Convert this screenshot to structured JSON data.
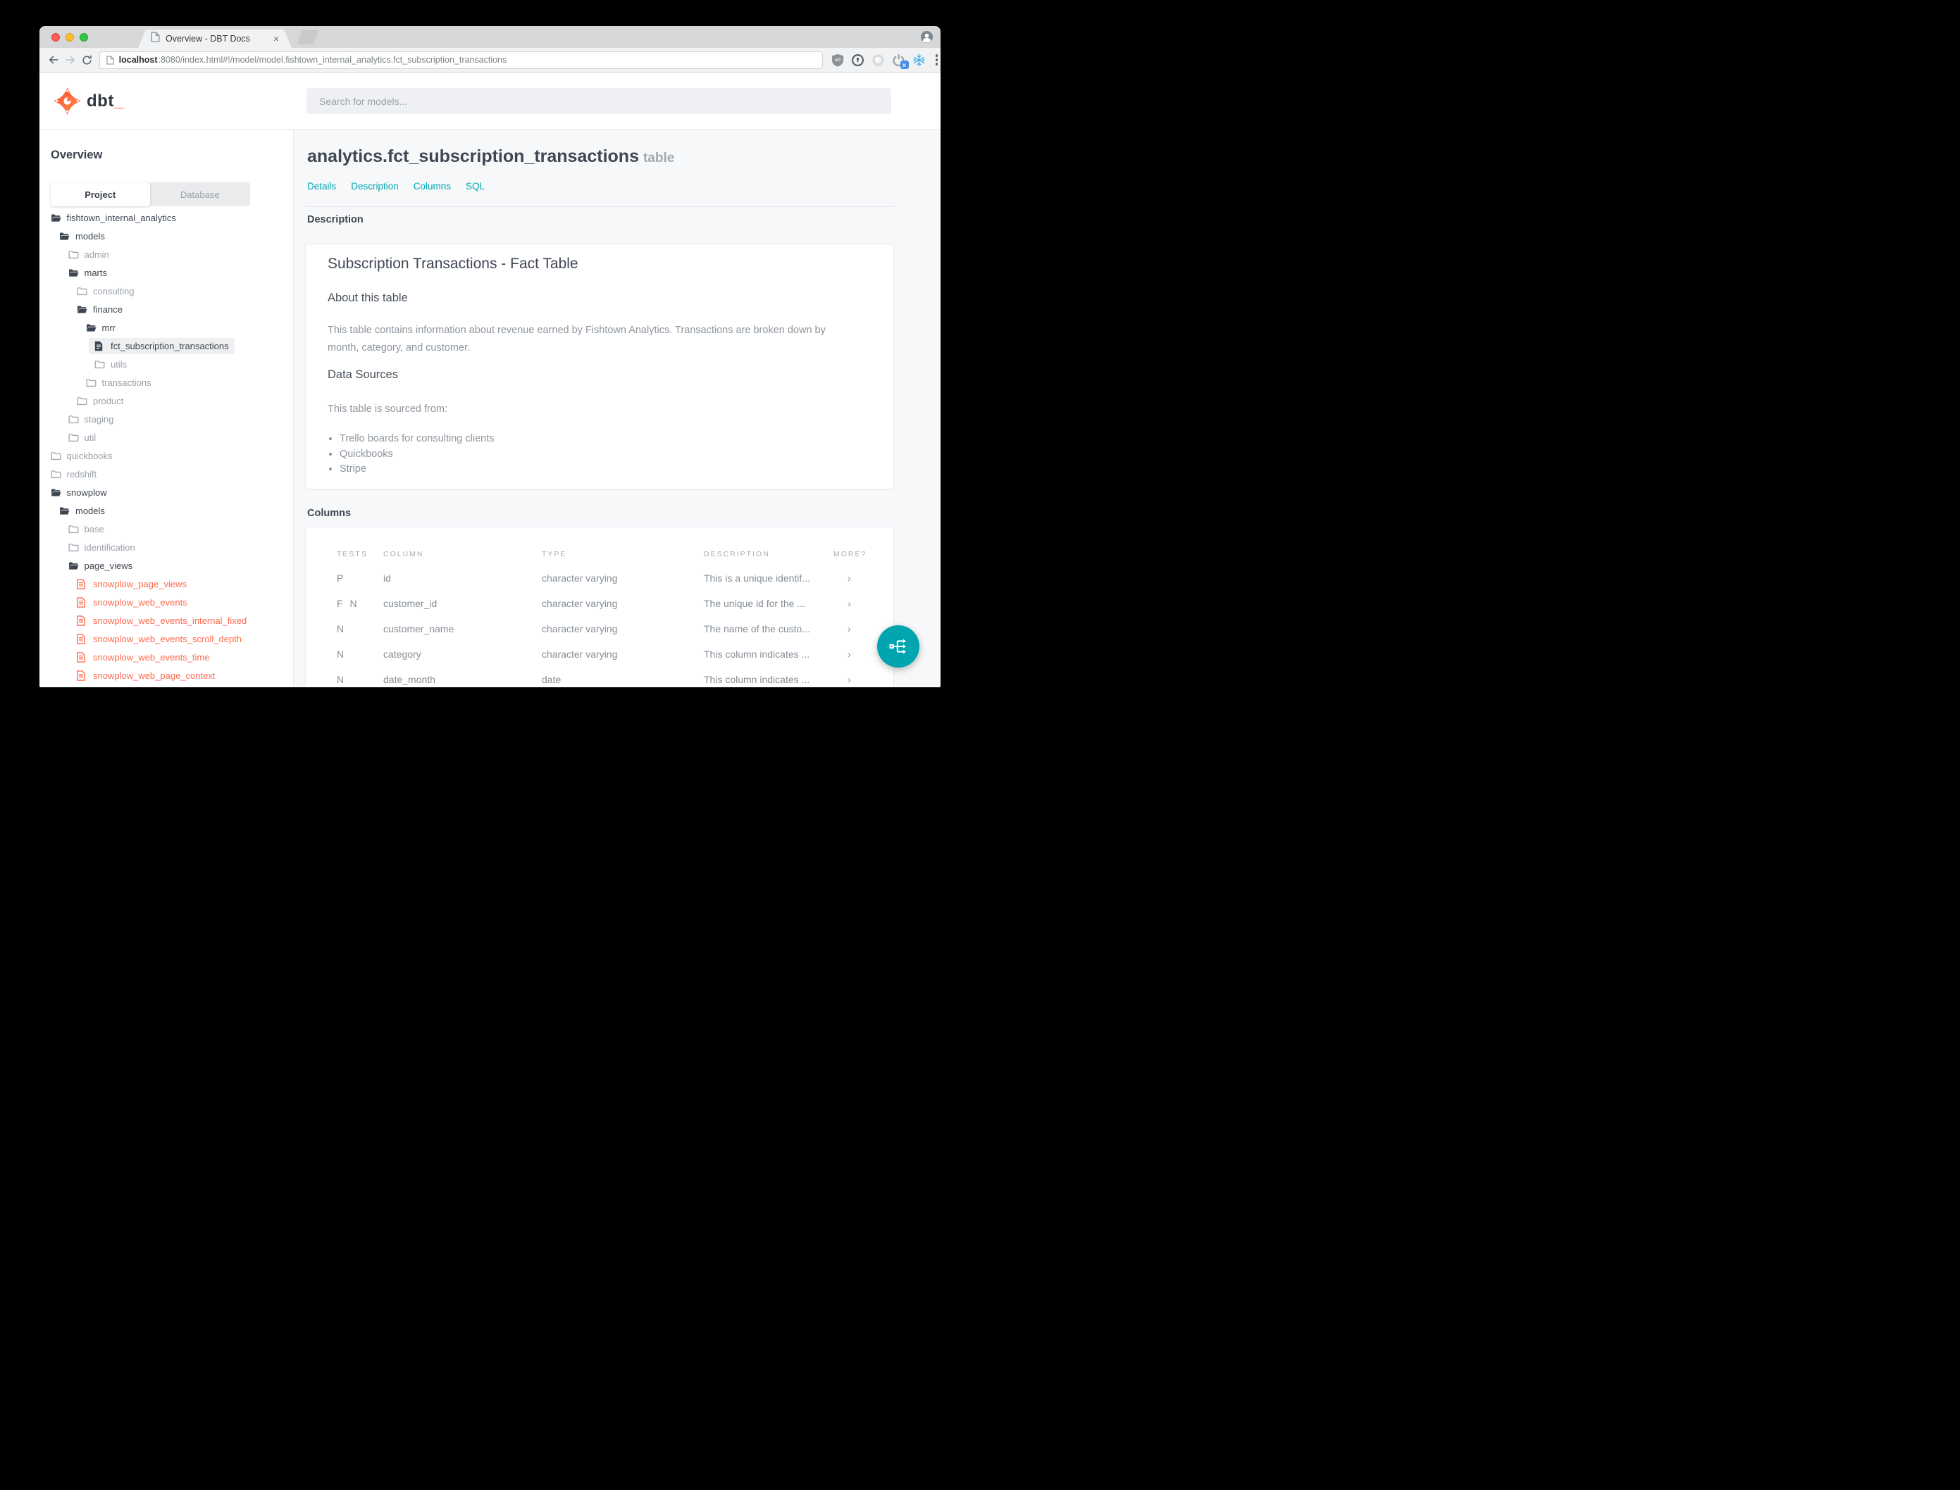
{
  "browser": {
    "tab_title": "Overview - DBT Docs",
    "close_glyph": "×",
    "url_host": "localhost",
    "url_rest": ":8080/index.html#!/model/model.fishtown_internal_analytics.fct_subscription_transactions"
  },
  "header": {
    "logo_text": "dbt",
    "logo_underscore": "_",
    "search_placeholder": "Search for models..."
  },
  "sidebar": {
    "title": "Overview",
    "tabs": {
      "project": "Project",
      "database": "Database"
    },
    "tree": [
      {
        "label": "fishtown_internal_analytics",
        "level": 0,
        "icon": "folder-open",
        "tone": "dark"
      },
      {
        "label": "models",
        "level": 1,
        "icon": "folder-open",
        "tone": "dark"
      },
      {
        "label": "admin",
        "level": 2,
        "icon": "folder-closed",
        "tone": "muted"
      },
      {
        "label": "marts",
        "level": 2,
        "icon": "folder-open",
        "tone": "dark"
      },
      {
        "label": "consulting",
        "level": 3,
        "icon": "folder-closed",
        "tone": "muted"
      },
      {
        "label": "finance",
        "level": 3,
        "icon": "folder-open",
        "tone": "dark"
      },
      {
        "label": "mrr",
        "level": 4,
        "icon": "folder-open",
        "tone": "dark"
      },
      {
        "label": "fct_subscription_transactions",
        "level": 5,
        "icon": "file-solid",
        "tone": "dark",
        "selected": true
      },
      {
        "label": "utils",
        "level": 5,
        "icon": "folder-closed",
        "tone": "muted"
      },
      {
        "label": "transactions",
        "level": 4,
        "icon": "folder-closed",
        "tone": "muted"
      },
      {
        "label": "product",
        "level": 3,
        "icon": "folder-closed",
        "tone": "muted"
      },
      {
        "label": "staging",
        "level": 2,
        "icon": "folder-closed",
        "tone": "muted"
      },
      {
        "label": "util",
        "level": 2,
        "icon": "folder-closed",
        "tone": "muted"
      },
      {
        "label": "quickbooks",
        "level": 0,
        "icon": "folder-closed",
        "tone": "muted"
      },
      {
        "label": "redshift",
        "level": 0,
        "icon": "folder-closed",
        "tone": "muted"
      },
      {
        "label": "snowplow",
        "level": 0,
        "icon": "folder-open",
        "tone": "dark"
      },
      {
        "label": "models",
        "level": 1,
        "icon": "folder-open",
        "tone": "dark"
      },
      {
        "label": "base",
        "level": 2,
        "icon": "folder-closed",
        "tone": "muted"
      },
      {
        "label": "identification",
        "level": 2,
        "icon": "folder-closed",
        "tone": "muted"
      },
      {
        "label": "page_views",
        "level": 2,
        "icon": "folder-open",
        "tone": "dark"
      },
      {
        "label": "snowplow_page_views",
        "level": 3,
        "icon": "file-lines",
        "tone": "red"
      },
      {
        "label": "snowplow_web_events",
        "level": 3,
        "icon": "file-lines",
        "tone": "red"
      },
      {
        "label": "snowplow_web_events_internal_fixed",
        "level": 3,
        "icon": "file-lines",
        "tone": "red"
      },
      {
        "label": "snowplow_web_events_scroll_depth",
        "level": 3,
        "icon": "file-lines",
        "tone": "red"
      },
      {
        "label": "snowplow_web_events_time",
        "level": 3,
        "icon": "file-lines",
        "tone": "red"
      },
      {
        "label": "snowplow_web_page_context",
        "level": 3,
        "icon": "file-lines",
        "tone": "red"
      }
    ]
  },
  "main": {
    "title": "analytics.fct_subscription_transactions",
    "title_suffix": "table",
    "nav": [
      "Details",
      "Description",
      "Columns",
      "SQL"
    ],
    "description_section": {
      "label": "Description",
      "card": {
        "heading": "Subscription Transactions - Fact Table",
        "about_heading": "About this table",
        "about_text": "This table contains information about revenue earned by Fishtown Analytics. Transactions are broken down by month, category, and customer.",
        "sources_heading": "Data Sources",
        "sources_intro": "This table is sourced from:",
        "sources": [
          "Trello boards for consulting clients",
          "Quickbooks",
          "Stripe"
        ]
      }
    },
    "columns_section": {
      "label": "Columns",
      "table": {
        "headers": [
          "TESTS",
          "COLUMN",
          "TYPE",
          "DESCRIPTION",
          "MORE?"
        ],
        "rows": [
          {
            "tests": "P",
            "column": "id",
            "type": "character varying",
            "description": "This is a unique identif...",
            "more": "›"
          },
          {
            "tests": "F N",
            "column": "customer_id",
            "type": "character varying",
            "description": "The unique id for the ...",
            "more": "›"
          },
          {
            "tests": "N",
            "column": "customer_name",
            "type": "character varying",
            "description": "The name of the custo...",
            "more": "›"
          },
          {
            "tests": "N",
            "column": "category",
            "type": "character varying",
            "description": "This column indicates ...",
            "more": "›"
          },
          {
            "tests": "N",
            "column": "date_month",
            "type": "date",
            "description": "This column indicates ...",
            "more": "›"
          }
        ]
      }
    }
  },
  "colors": {
    "accent": "#00a7b3",
    "red": "#ff6a4d",
    "logo_orange": "#ff5c3c"
  }
}
